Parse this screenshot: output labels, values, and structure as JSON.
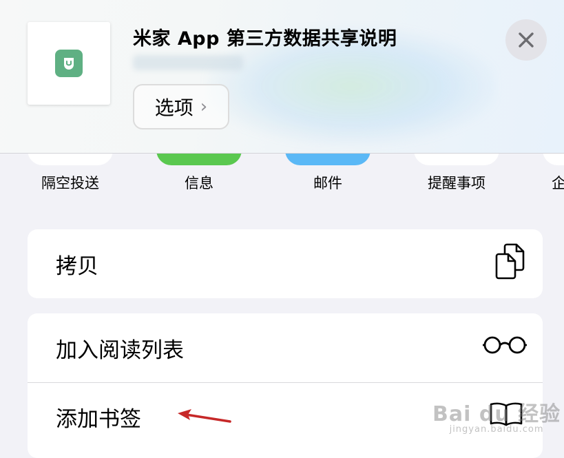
{
  "header": {
    "title": "米家 App 第三方数据共享说明",
    "options_label": "选项",
    "options_chevron": "›"
  },
  "share_targets": [
    {
      "label": "隔空投送",
      "color": "#ffffff"
    },
    {
      "label": "信息",
      "color": "#5ac84f"
    },
    {
      "label": "邮件",
      "color": "#5ab8f6"
    },
    {
      "label": "提醒事项",
      "color": "#ffffff"
    },
    {
      "label": "企",
      "color": "#ffffff"
    }
  ],
  "actions": {
    "copy_label": "拷贝",
    "reading_list_label": "加入阅读列表",
    "bookmark_label": "添加书签"
  },
  "icons": {
    "logo": "mi-home-logo-icon",
    "close": "close-icon",
    "copy": "copy-icon",
    "reading_list": "glasses-icon",
    "bookmark": "book-icon",
    "annotation": "red-arrow-icon"
  },
  "colors": {
    "logo_green": "#5fb083",
    "annotation_red": "#c62828",
    "background": "#f2f2f7"
  },
  "watermark": {
    "main": "Bai du 经验",
    "sub": "jingyan.baidu.com"
  }
}
